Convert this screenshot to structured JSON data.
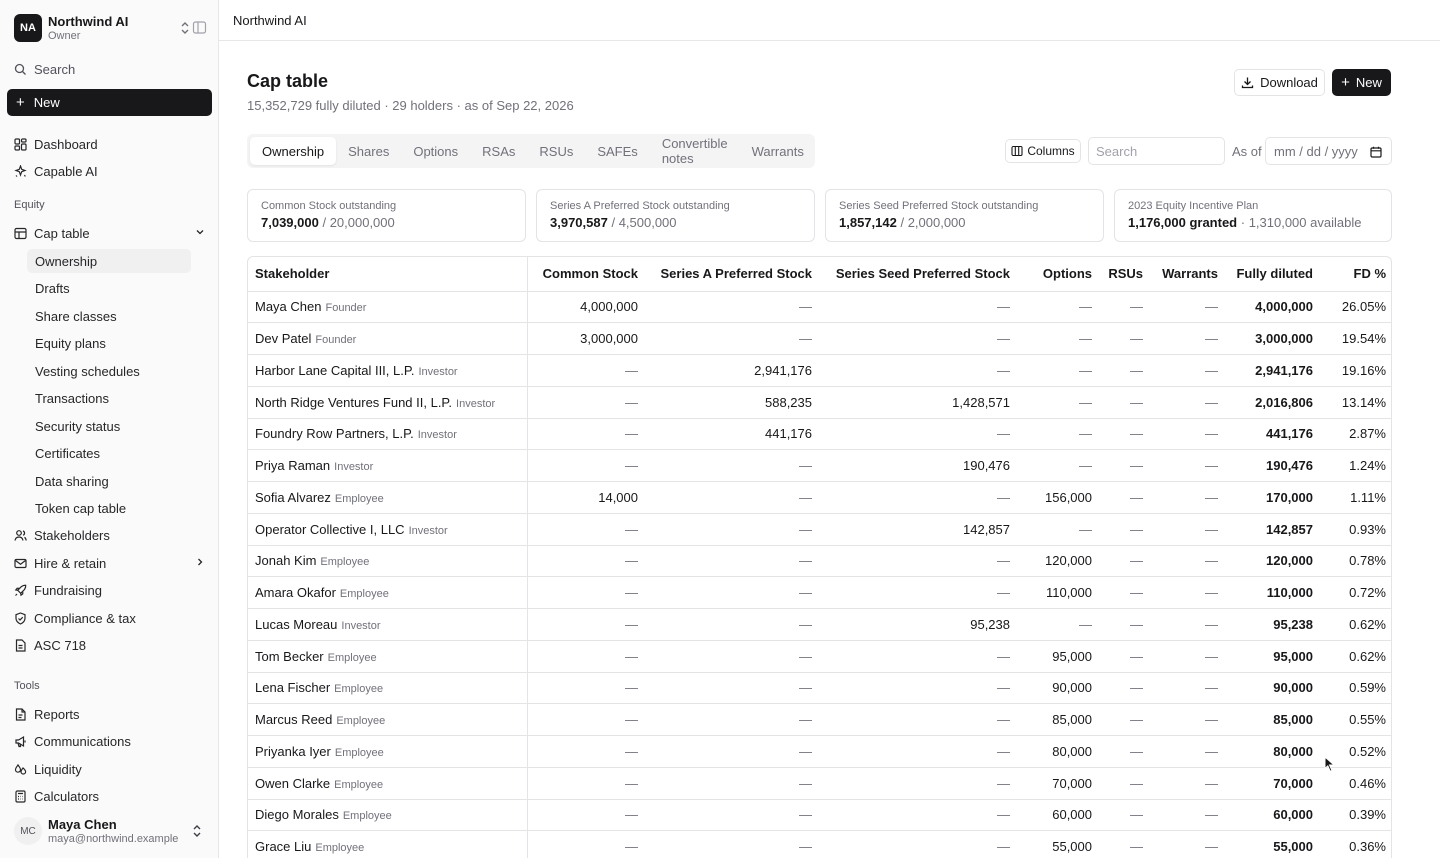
{
  "org": {
    "initials": "NA",
    "name": "Northwind AI",
    "role": "Owner"
  },
  "sidebar": {
    "search_label": "Search",
    "new_label": "New",
    "top_items": [
      {
        "label": "Dashboard"
      },
      {
        "label": "Capable AI"
      }
    ],
    "equity_label": "Equity",
    "cap_table_label": "Cap table",
    "cap_table_subitems": [
      {
        "label": "Ownership"
      },
      {
        "label": "Drafts"
      },
      {
        "label": "Share classes"
      },
      {
        "label": "Equity plans"
      },
      {
        "label": "Vesting schedules"
      },
      {
        "label": "Transactions"
      },
      {
        "label": "Security status"
      },
      {
        "label": "Certificates"
      },
      {
        "label": "Data sharing"
      },
      {
        "label": "Token cap table"
      }
    ],
    "equity_items": [
      {
        "label": "Stakeholders"
      },
      {
        "label": "Hire & retain"
      },
      {
        "label": "Fundraising"
      },
      {
        "label": "Compliance & tax"
      },
      {
        "label": "ASC 718"
      }
    ],
    "tools_label": "Tools",
    "tools_items": [
      {
        "label": "Reports"
      },
      {
        "label": "Communications"
      },
      {
        "label": "Liquidity"
      },
      {
        "label": "Calculators"
      }
    ]
  },
  "user": {
    "initials": "MC",
    "name": "Maya Chen",
    "email": "maya@northwind.example"
  },
  "topbar": {
    "title": "Northwind AI"
  },
  "page": {
    "title": "Cap table",
    "subtitle": "15,352,729 fully diluted · 29 holders · as of Sep 22, 2026",
    "download_label": "Download",
    "new_label": "New"
  },
  "tabs": [
    "Ownership",
    "Shares",
    "Options",
    "RSAs",
    "RSUs",
    "SAFEs",
    "Convertible notes",
    "Warrants"
  ],
  "toolbar": {
    "columns_label": "Columns",
    "search_placeholder": "Search",
    "as_of_label": "As of",
    "date_placeholder": "mm / dd / yyyy"
  },
  "cards": [
    {
      "label": "Common Stock outstanding",
      "value": "7,039,000",
      "sep": " / ",
      "secondary": "20,000,000"
    },
    {
      "label": "Series A Preferred Stock outstanding",
      "value": "3,970,587",
      "sep": " / ",
      "secondary": "4,500,000"
    },
    {
      "label": "Series Seed Preferred Stock outstanding",
      "value": "1,857,142",
      "sep": " / ",
      "secondary": "2,000,000"
    },
    {
      "label": "2023 Equity Incentive Plan",
      "value": "1,176,000 granted",
      "sep": " · ",
      "secondary": "1,310,000 available"
    }
  ],
  "table": {
    "columns": [
      "Stakeholder",
      "Common Stock",
      "Series A Preferred Stock",
      "Series Seed Preferred Stock",
      "Options",
      "RSUs",
      "Warrants",
      "Fully diluted",
      "FD %"
    ],
    "rows": [
      {
        "name": "Maya Chen",
        "role": "Founder",
        "cells": [
          "4,000,000",
          "—",
          "—",
          "—",
          "—",
          "—",
          "4,000,000",
          "26.05%"
        ]
      },
      {
        "name": "Dev Patel",
        "role": "Founder",
        "cells": [
          "3,000,000",
          "—",
          "—",
          "—",
          "—",
          "—",
          "3,000,000",
          "19.54%"
        ]
      },
      {
        "name": "Harbor Lane Capital III, L.P.",
        "role": "Investor",
        "cells": [
          "—",
          "2,941,176",
          "—",
          "—",
          "—",
          "—",
          "2,941,176",
          "19.16%"
        ]
      },
      {
        "name": "North Ridge Ventures Fund II, L.P.",
        "role": "Investor",
        "cells": [
          "—",
          "588,235",
          "1,428,571",
          "—",
          "—",
          "—",
          "2,016,806",
          "13.14%"
        ]
      },
      {
        "name": "Foundry Row Partners, L.P.",
        "role": "Investor",
        "cells": [
          "—",
          "441,176",
          "—",
          "—",
          "—",
          "—",
          "441,176",
          "2.87%"
        ]
      },
      {
        "name": "Priya Raman",
        "role": "Investor",
        "cells": [
          "—",
          "—",
          "190,476",
          "—",
          "—",
          "—",
          "190,476",
          "1.24%"
        ]
      },
      {
        "name": "Sofia Alvarez",
        "role": "Employee",
        "cells": [
          "14,000",
          "—",
          "—",
          "156,000",
          "—",
          "—",
          "170,000",
          "1.11%"
        ]
      },
      {
        "name": "Operator Collective I, LLC",
        "role": "Investor",
        "cells": [
          "—",
          "—",
          "142,857",
          "—",
          "—",
          "—",
          "142,857",
          "0.93%"
        ]
      },
      {
        "name": "Jonah Kim",
        "role": "Employee",
        "cells": [
          "—",
          "—",
          "—",
          "120,000",
          "—",
          "—",
          "120,000",
          "0.78%"
        ]
      },
      {
        "name": "Amara Okafor",
        "role": "Employee",
        "cells": [
          "—",
          "—",
          "—",
          "110,000",
          "—",
          "—",
          "110,000",
          "0.72%"
        ]
      },
      {
        "name": "Lucas Moreau",
        "role": "Investor",
        "cells": [
          "—",
          "—",
          "95,238",
          "—",
          "—",
          "—",
          "95,238",
          "0.62%"
        ]
      },
      {
        "name": "Tom Becker",
        "role": "Employee",
        "cells": [
          "—",
          "—",
          "—",
          "95,000",
          "—",
          "—",
          "95,000",
          "0.62%"
        ]
      },
      {
        "name": "Lena Fischer",
        "role": "Employee",
        "cells": [
          "—",
          "—",
          "—",
          "90,000",
          "—",
          "—",
          "90,000",
          "0.59%"
        ]
      },
      {
        "name": "Marcus Reed",
        "role": "Employee",
        "cells": [
          "—",
          "—",
          "—",
          "85,000",
          "—",
          "—",
          "85,000",
          "0.55%"
        ]
      },
      {
        "name": "Priyanka Iyer",
        "role": "Employee",
        "cells": [
          "—",
          "—",
          "—",
          "80,000",
          "—",
          "—",
          "80,000",
          "0.52%"
        ]
      },
      {
        "name": "Owen Clarke",
        "role": "Employee",
        "cells": [
          "—",
          "—",
          "—",
          "70,000",
          "—",
          "—",
          "70,000",
          "0.46%"
        ]
      },
      {
        "name": "Diego Morales",
        "role": "Employee",
        "cells": [
          "—",
          "—",
          "—",
          "60,000",
          "—",
          "—",
          "60,000",
          "0.39%"
        ]
      },
      {
        "name": "Grace Liu",
        "role": "Employee",
        "cells": [
          "—",
          "—",
          "—",
          "55,000",
          "—",
          "—",
          "55,000",
          "0.36%"
        ]
      }
    ]
  }
}
